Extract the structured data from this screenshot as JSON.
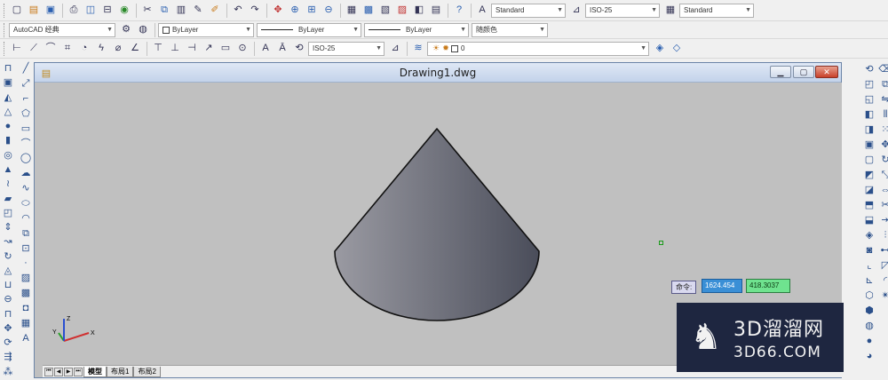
{
  "toolbar_row1": {
    "text_style": "Standard",
    "dim_style": "ISO-25",
    "table_style": "Standard"
  },
  "toolbar_row2": {
    "workspace": "AutoCAD 经典",
    "color": "ByLayer",
    "linetype": "ByLayer",
    "lineweight": "ByLayer",
    "plot_style": "随颜色"
  },
  "toolbar_row3": {
    "dim_style": "ISO-25",
    "layer": "0"
  },
  "document": {
    "title": "Drawing1.dwg",
    "minimize_icon": "minimize-icon",
    "maximize_icon": "maximize-icon",
    "close_icon": "close-icon"
  },
  "dynamic_input": {
    "prompt": "命令:",
    "x_value": "1624.454",
    "y_value": "418.3037"
  },
  "ucs": {
    "x_label": "X",
    "y_label": "Y",
    "z_label": "Z"
  },
  "layout_tabs": [
    {
      "label": "模型",
      "active": true
    },
    {
      "label": "布局1",
      "active": false
    },
    {
      "label": "布局2",
      "active": false
    }
  ],
  "watermark": {
    "brand": "3D溜溜网",
    "url": "3D66.COM",
    "logo_icon": "deer-icon"
  },
  "colors": {
    "canvas_bg": "#c0c0c0",
    "cone_light": "#9a9aa2",
    "cone_dark": "#4a4d5a",
    "x_axis": "#d03030",
    "y_axis": "#2aa02a",
    "z_axis": "#2a4fd0"
  }
}
